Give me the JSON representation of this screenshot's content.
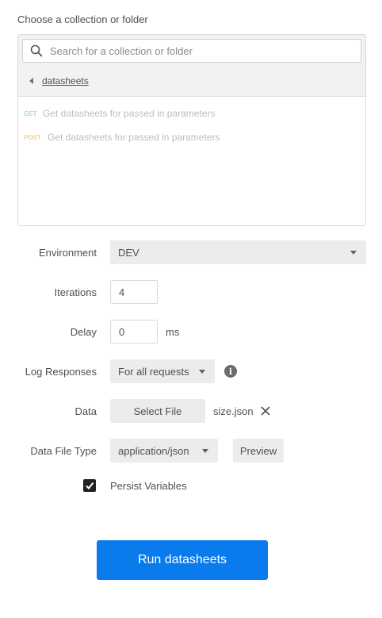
{
  "collection": {
    "heading": "Choose a collection or folder",
    "search_placeholder": "Search for a collection or folder",
    "breadcrumb": "datasheets",
    "requests": [
      {
        "method": "GET",
        "name": "Get datasheets for passed in parameters"
      },
      {
        "method": "POST",
        "name": "Get datasheets for passed in parameters"
      }
    ]
  },
  "form": {
    "environment": {
      "label": "Environment",
      "value": "DEV"
    },
    "iterations": {
      "label": "Iterations",
      "value": "4"
    },
    "delay": {
      "label": "Delay",
      "value": "0",
      "unit": "ms"
    },
    "log_responses": {
      "label": "Log Responses",
      "value": "For all requests"
    },
    "data": {
      "label": "Data",
      "button": "Select File",
      "filename": "size.json"
    },
    "data_file_type": {
      "label": "Data File Type",
      "value": "application/json",
      "preview": "Preview"
    },
    "persist_variables": {
      "label": "Persist Variables",
      "checked": true
    }
  },
  "run_button": "Run datasheets",
  "colors": {
    "accent": "#097bed",
    "get": "#a8dcc5",
    "post": "#f7d27a"
  }
}
